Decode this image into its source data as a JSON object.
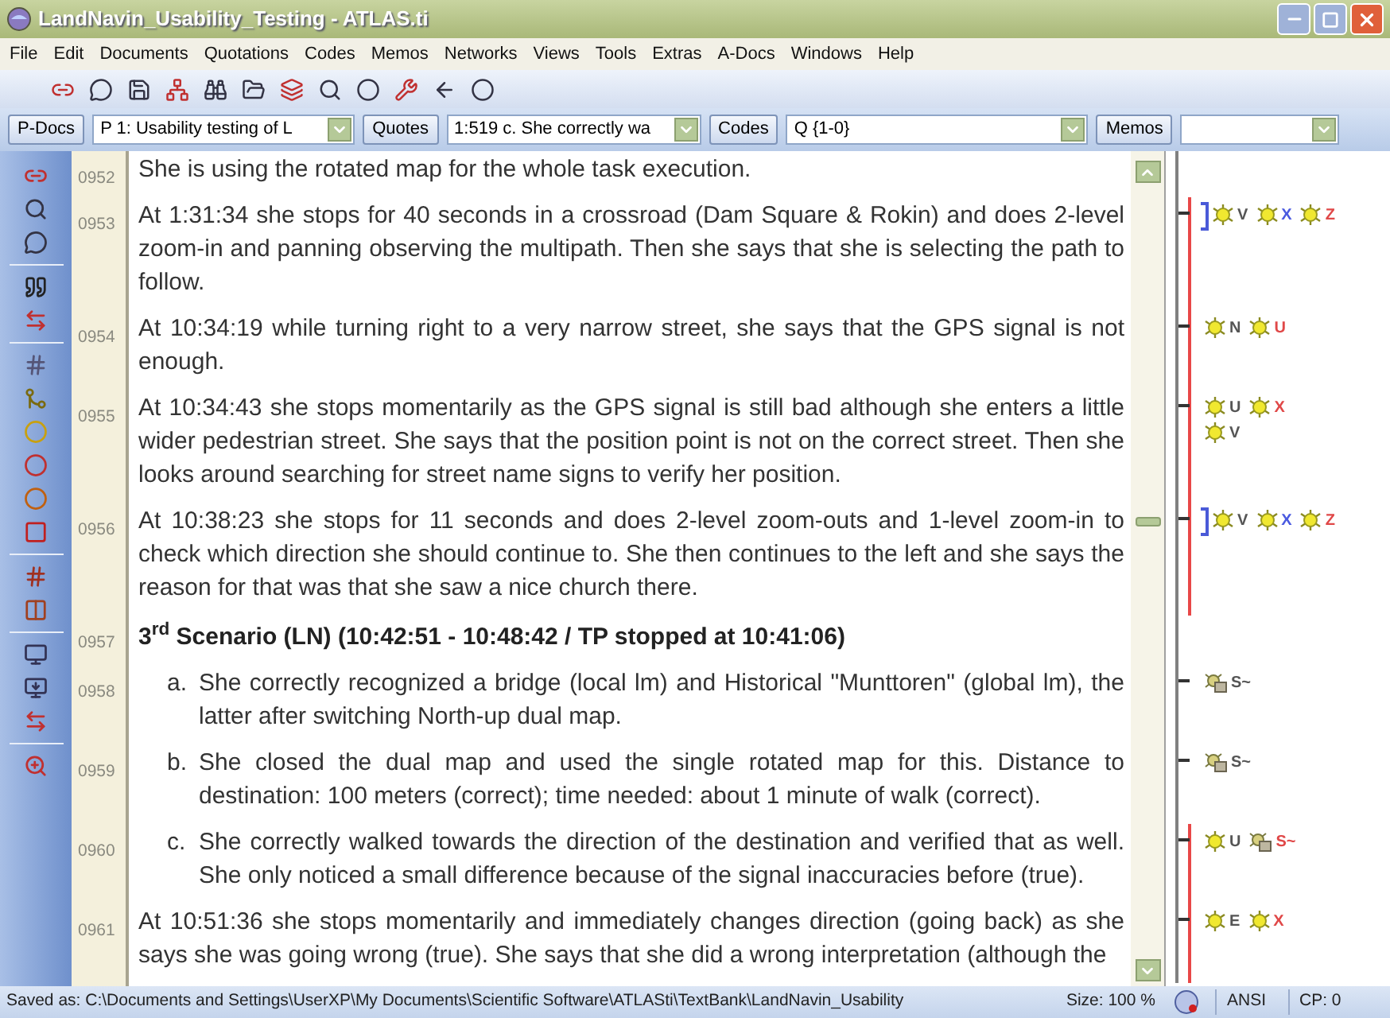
{
  "window": {
    "title": "LandNavin_Usability_Testing - ATLAS.ti"
  },
  "menu": [
    "File",
    "Edit",
    "Documents",
    "Quotations",
    "Codes",
    "Memos",
    "Networks",
    "Views",
    "Tools",
    "Extras",
    "A-Docs",
    "Windows",
    "Help"
  ],
  "selectors": [
    {
      "button": "P-Docs",
      "value": "P 1: Usability testing of L"
    },
    {
      "button": "Quotes",
      "value": "1:519 c. She correctly wa"
    },
    {
      "button": "Codes",
      "value": "Q {1-0}"
    },
    {
      "button": "Memos"
    }
  ],
  "document": [
    {
      "line": "0952",
      "kind": "paragraph",
      "text": "She is using the rotated map for the whole task execution."
    },
    {
      "line": "0953",
      "kind": "paragraph",
      "text": "At 1:31:34 she stops for 40 seconds in a crossroad (Dam Square & Rokin) and does 2-level zoom-in and panning observing the multipath. Then she says that she is selecting the path to follow.",
      "margin": {
        "bracket": {
          "color": "#e84848"
        },
        "code_bracket": {
          "color": "#4a5ad8"
        },
        "lines": [
          [
            {
              "kind": "code",
              "label": "V",
              "color": "#555555"
            },
            {
              "kind": "code",
              "label": "X",
              "color": "#4a5ae0"
            },
            {
              "kind": "code",
              "label": "Z",
              "color": "#e04848"
            }
          ]
        ]
      }
    },
    {
      "line": "0954",
      "kind": "paragraph",
      "text": "At 10:34:19 while turning right to a very narrow street, she says that the GPS signal is not enough.",
      "margin": {
        "bracket": {
          "color": "#e84848"
        },
        "lines": [
          [
            {
              "kind": "code",
              "label": "N",
              "color": "#555555"
            },
            {
              "kind": "code",
              "label": "U",
              "color": "#e04848"
            }
          ]
        ]
      }
    },
    {
      "line": "0955",
      "kind": "paragraph",
      "text": "At 10:34:43 she stops momentarily as the GPS signal is still bad although she enters a little wider pedestrian street. She says that the position point is not on the correct street. Then she looks around searching for street name signs to verify her position.",
      "margin": {
        "bracket": {
          "color": "#e84848"
        },
        "lines": [
          [
            {
              "kind": "code",
              "label": "U",
              "color": "#555555"
            },
            {
              "kind": "code",
              "label": "X",
              "color": "#e04848"
            }
          ],
          [
            {
              "kind": "code",
              "label": "V",
              "color": "#555555"
            }
          ]
        ]
      }
    },
    {
      "line": "0956",
      "kind": "paragraph",
      "text": "At 10:38:23 she stops for 11 seconds and does 2-level zoom-outs and 1-level zoom-in to check which direction she should continue to. She then continues to the left and she says the reason for that was that she saw a nice church there.",
      "margin": {
        "bracket": {
          "color": "#e84848"
        },
        "code_bracket": {
          "color": "#4a5ad8"
        },
        "lines": [
          [
            {
              "kind": "code",
              "label": "V",
              "color": "#555555"
            },
            {
              "kind": "code",
              "label": "X",
              "color": "#4a5ae0"
            },
            {
              "kind": "code",
              "label": "Z",
              "color": "#e04848"
            }
          ]
        ]
      }
    },
    {
      "line": "0957",
      "kind": "heading",
      "text": "3$^{rd}$ Scenario (LN) (10:42:51 - 10:48:42 / TP stopped at 10:41:06)"
    },
    {
      "line": "0958",
      "kind": "list_item",
      "marker": "a.",
      "text": "She correctly recognized a bridge (local lm) and Historical \"Munttoren\" (global lm), the latter after switching North-up dual map.",
      "margin": {
        "lines": [
          [
            {
              "kind": "group",
              "label": "S~",
              "color": "#555555"
            }
          ]
        ]
      }
    },
    {
      "line": "0959",
      "kind": "list_item",
      "marker": "b.",
      "text": "She closed the dual map and used the single rotated map for this. Distance to destination: 100 meters (correct); time needed: about 1 minute of walk (correct).",
      "margin": {
        "lines": [
          [
            {
              "kind": "group",
              "label": "S~",
              "color": "#555555"
            }
          ]
        ]
      }
    },
    {
      "line": "0960",
      "kind": "list_item",
      "marker": "c.",
      "text": "She correctly walked towards the direction of the destination and verified that as well. She only noticed a small difference because of the signal inaccuracies before (true).",
      "margin": {
        "bracket": {
          "color": "#e84848"
        },
        "lines": [
          [
            {
              "kind": "code",
              "label": "U",
              "color": "#555555"
            },
            {
              "kind": "group",
              "label": "S~",
              "color": "#e04848"
            }
          ]
        ]
      }
    },
    {
      "line": "0961",
      "kind": "paragraph",
      "text": "At 10:51:36 she stops momentarily and immediately changes direction (going back) as she says she was going wrong (true). She says that she did a wrong interpretation (although the",
      "margin": {
        "bracket": {
          "color": "#e84848"
        },
        "lines": [
          [
            {
              "kind": "code",
              "label": "E",
              "color": "#555555"
            },
            {
              "kind": "code",
              "label": "X",
              "color": "#e04848"
            }
          ]
        ]
      }
    }
  ],
  "status_bar": {
    "path": "Saved as: C:\\Documents and Settings\\UserXP\\My Documents\\Scientific Software\\ATLASti\\TextBank\\LandNavin_Usability",
    "size": "Size: 100 %",
    "encoding": "ANSI",
    "cp": "CP: 0"
  }
}
